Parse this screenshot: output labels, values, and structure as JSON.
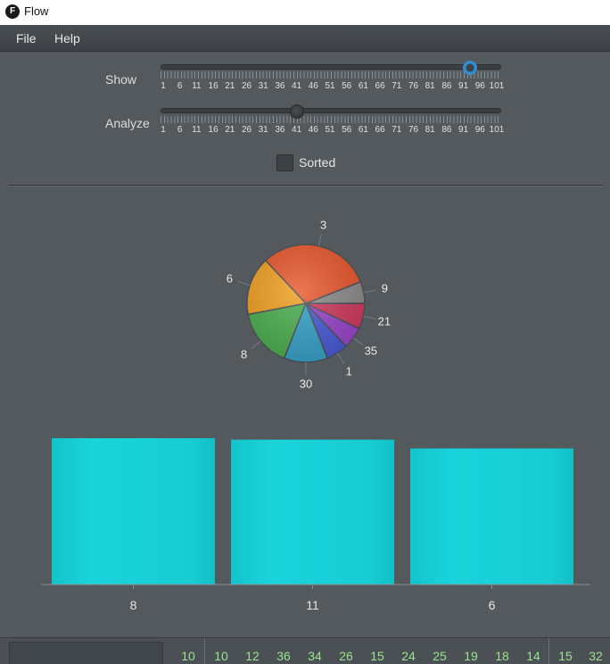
{
  "window": {
    "title": "Flow",
    "icon_letter": "F"
  },
  "menu": {
    "items": [
      "File",
      "Help"
    ]
  },
  "controls": {
    "show": {
      "label": "Show",
      "min": 1,
      "max": 101,
      "value": 93
    },
    "analyze": {
      "label": "Analyze",
      "min": 1,
      "max": 101,
      "value": 41
    },
    "tick_labels": [
      "1",
      "6",
      "11",
      "16",
      "21",
      "26",
      "31",
      "36",
      "41",
      "46",
      "51",
      "56",
      "61",
      "66",
      "71",
      "76",
      "81",
      "86",
      "91",
      "96",
      "101"
    ],
    "sorted": {
      "label": "Sorted",
      "checked": false
    }
  },
  "chart_data": [
    {
      "type": "pie",
      "slices": [
        {
          "label": "9",
          "value": 6,
          "color": "#8c8c8c"
        },
        {
          "label": "3",
          "value": 31,
          "color": "#e8592f"
        },
        {
          "label": "6",
          "value": 16,
          "color": "#f0a023"
        },
        {
          "label": "8",
          "value": 16,
          "color": "#4cae50"
        },
        {
          "label": "30",
          "value": 12,
          "color": "#38a1c8"
        },
        {
          "label": "1",
          "value": 6,
          "color": "#4a5bd6"
        },
        {
          "label": "35",
          "value": 6,
          "color": "#9a46c9"
        },
        {
          "label": "21",
          "value": 7,
          "color": "#d03a5e"
        }
      ]
    },
    {
      "type": "bar",
      "categories": [
        "8",
        "11",
        "6"
      ],
      "values": [
        100,
        99,
        93
      ],
      "ylim": [
        0,
        100
      ],
      "color": "#18cfd6"
    }
  ],
  "status": {
    "input_value": "",
    "first_value": "10",
    "values": [
      "10",
      "12",
      "36",
      "34",
      "26",
      "15",
      "24",
      "25",
      "19",
      "18",
      "14"
    ],
    "tail_values": [
      "15",
      "32"
    ]
  }
}
